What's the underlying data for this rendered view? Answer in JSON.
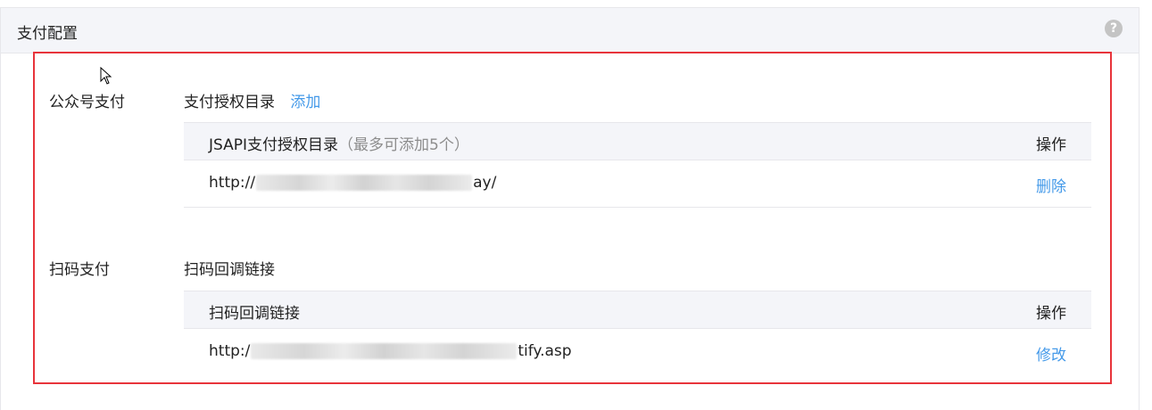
{
  "panel": {
    "title": "支付配置",
    "help_icon": "?"
  },
  "gzh": {
    "label": "公众号支付",
    "section_title": "支付授权目录",
    "add_link": "添加",
    "table": {
      "header_main": "JSAPI支付授权目录",
      "header_hint": "（最多可添加5个）",
      "header_op": "操作",
      "rows": [
        {
          "url_prefix": "http://",
          "url_suffix": "ay/",
          "op": "删除"
        }
      ]
    }
  },
  "scan": {
    "label": "扫码支付",
    "section_title": "扫码回调链接",
    "table": {
      "header_main": "扫码回调链接",
      "header_op": "操作",
      "rows": [
        {
          "url_prefix": "http:/",
          "url_suffix": "tify.asp",
          "op": "修改"
        }
      ]
    }
  },
  "colors": {
    "link": "#459ae9",
    "highlight_border": "#e8343b",
    "header_bg": "#f4f5f9"
  }
}
